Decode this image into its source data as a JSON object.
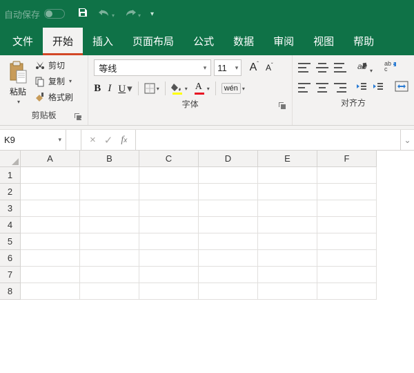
{
  "titlebar": {
    "autosave_label": "自动保存",
    "autosave_state": "关"
  },
  "tabs": {
    "file": "文件",
    "home": "开始",
    "insert": "插入",
    "layout": "页面布局",
    "formulas": "公式",
    "data": "数据",
    "review": "审阅",
    "view": "视图",
    "help": "帮助"
  },
  "ribbon": {
    "clipboard": {
      "paste": "粘贴",
      "cut": "剪切",
      "copy": "复制",
      "format_painter": "格式刷",
      "group_label": "剪贴板"
    },
    "font": {
      "name": "等线",
      "size": "11",
      "increase": "A",
      "decrease": "A",
      "bold": "B",
      "italic": "I",
      "underline": "U",
      "phonetic": "wén",
      "group_label": "字体"
    },
    "alignment": {
      "group_label": "对齐方"
    }
  },
  "namebox": {
    "value": "K9"
  },
  "formula": {
    "value": ""
  },
  "grid": {
    "columns": [
      "A",
      "B",
      "C",
      "D",
      "E",
      "F"
    ],
    "rows": [
      "1",
      "2",
      "3",
      "4",
      "5",
      "6",
      "7",
      "8"
    ]
  }
}
